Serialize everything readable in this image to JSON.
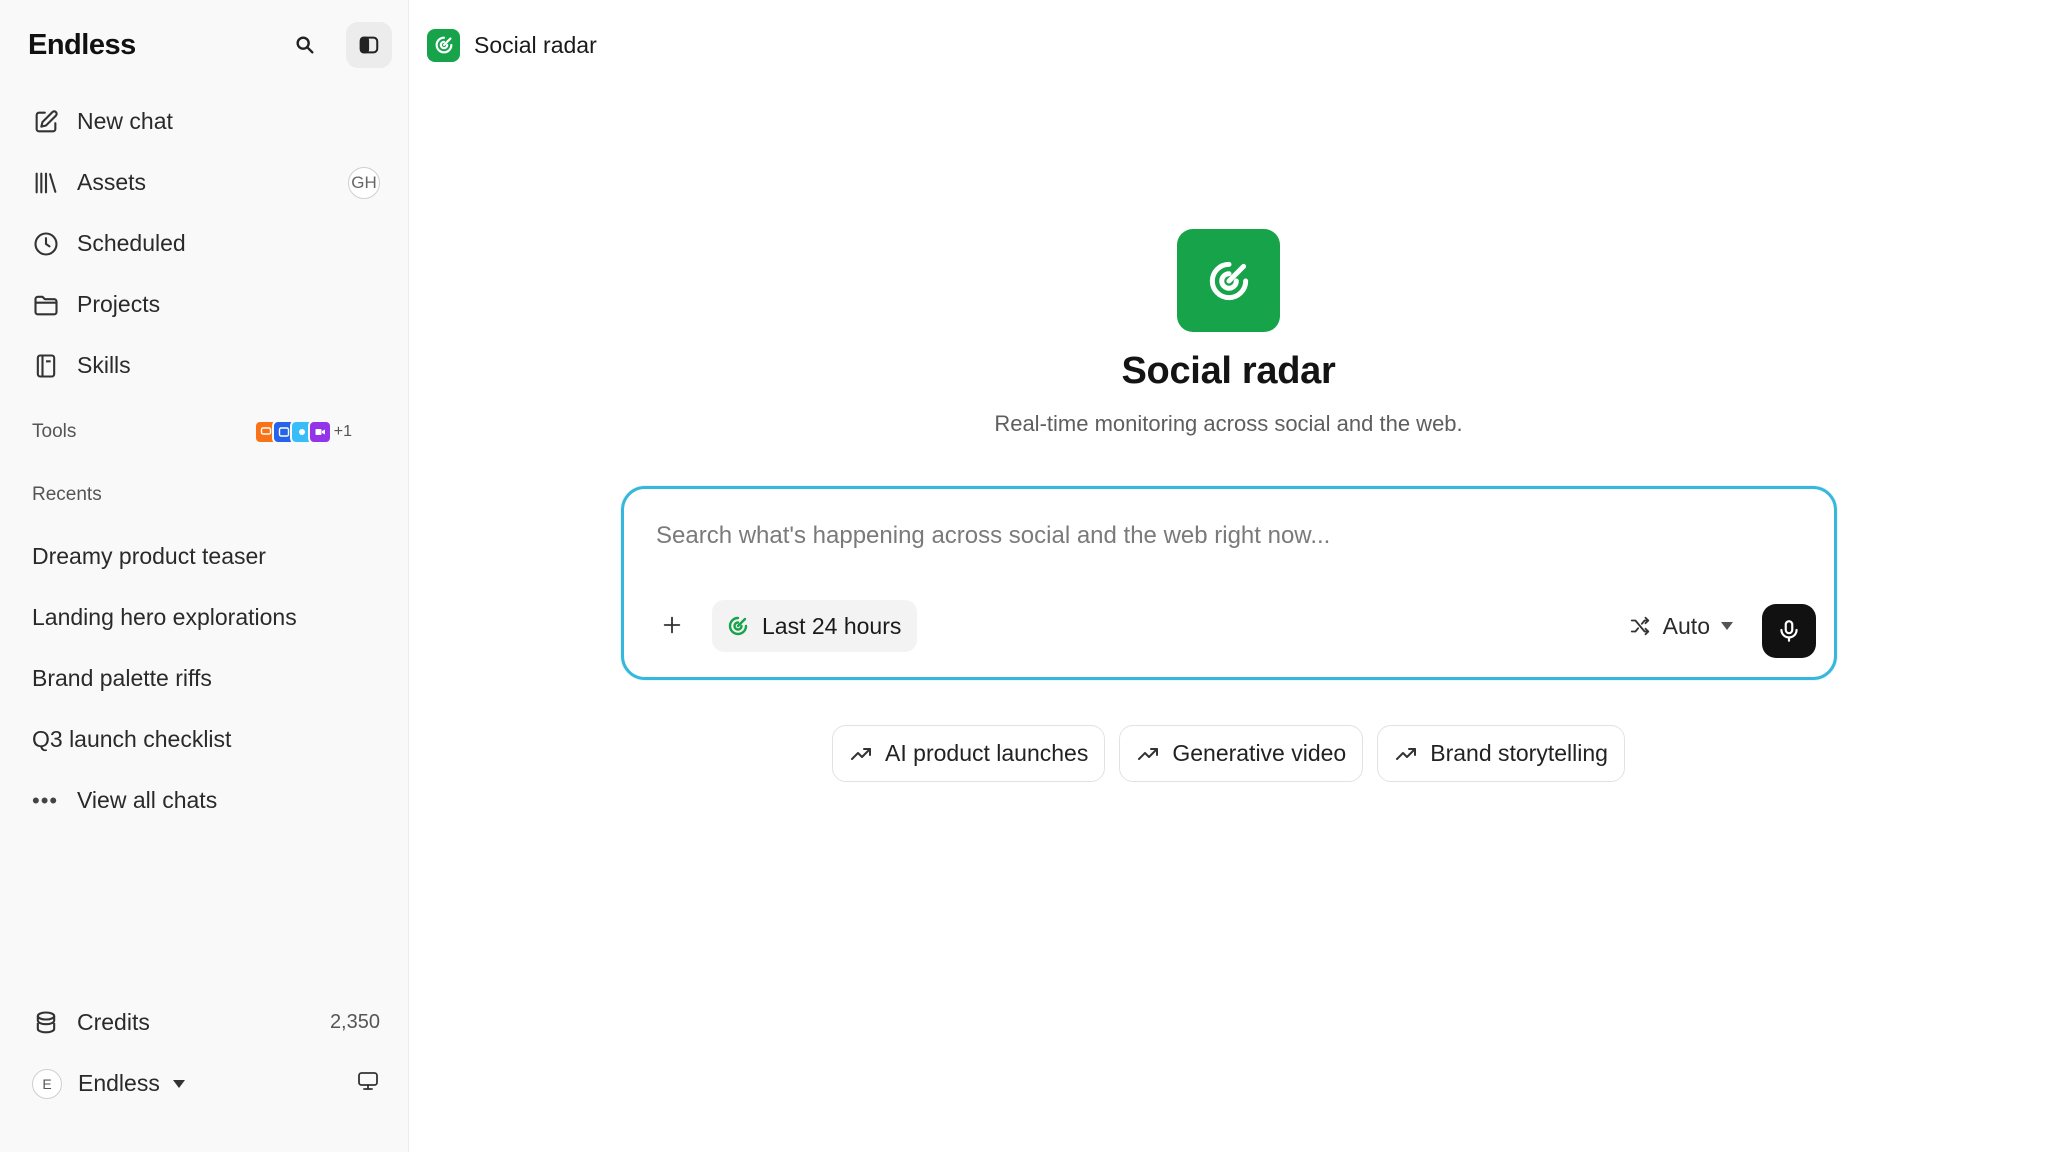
{
  "sidebar": {
    "brand": "Endless",
    "nav": [
      {
        "label": "New chat",
        "icon": "edit-icon"
      },
      {
        "label": "Assets",
        "icon": "library-icon",
        "badge": "GH"
      },
      {
        "label": "Scheduled",
        "icon": "clock-icon"
      },
      {
        "label": "Projects",
        "icon": "folder-icon"
      },
      {
        "label": "Skills",
        "icon": "book-icon"
      }
    ],
    "tools_label": "Tools",
    "tools_more": "+1",
    "recents_label": "Recents",
    "recents": [
      "Dreamy product teaser",
      "Landing hero explorations",
      "Brand palette riffs",
      "Q3 launch checklist"
    ],
    "view_all": "View all chats",
    "credits_label": "Credits",
    "credits_value": "2,350",
    "account_initial": "E",
    "account_name": "Endless"
  },
  "main": {
    "topbar_title": "Social radar",
    "hero_title": "Social radar",
    "hero_subtitle": "Real-time monitoring across social and the web.",
    "composer": {
      "placeholder": "Search what's happening across social and the web right now...",
      "time_filter": "Last 24 hours",
      "model": "Auto"
    },
    "suggestions": [
      "AI product launches",
      "Generative video",
      "Brand storytelling"
    ]
  },
  "colors": {
    "accent_green": "#16a34a",
    "composer_border": "#36b7db"
  }
}
